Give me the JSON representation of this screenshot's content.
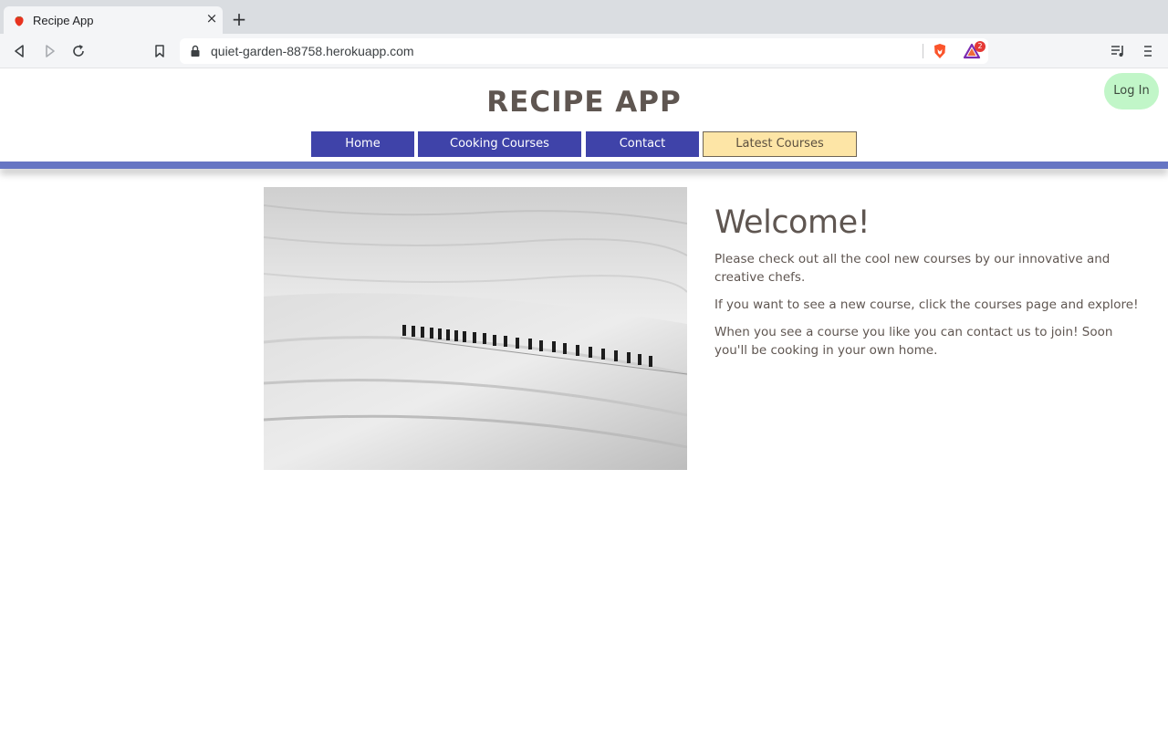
{
  "browser": {
    "tab_title": "Recipe App",
    "tab_close_symbol": "×",
    "new_tab_symbol": "+",
    "url": "quiet-garden-88758.herokuapp.com",
    "rewards_badge_count": "2",
    "icons": [
      "back-icon",
      "forward-icon",
      "reload-icon",
      "bookmark-icon",
      "lock-icon",
      "brave-shields-icon",
      "brave-rewards-icon",
      "playlist-icon",
      "menu-icon"
    ]
  },
  "site": {
    "title": "RECIPE APP",
    "login_label": "Log In",
    "nav": {
      "home": "Home",
      "cooking_courses": "Cooking Courses",
      "contact": "Contact",
      "latest_courses": "Latest Courses"
    },
    "welcome": {
      "heading": "Welcome!",
      "para1": "Please check out all the cool new courses by our innovative and creative chefs.",
      "para2": "If you want to see a new course, click the courses page and explore!",
      "para3": "When you see a course you like you can contact us to join! Soon you'll be cooking in your own home."
    },
    "colors": {
      "title": "#5f5651",
      "nav_blue": "#3f43a9",
      "nav_yellow": "#fde5a6",
      "rule": "#6675c3",
      "login_bg": "#c1f6c8"
    }
  }
}
